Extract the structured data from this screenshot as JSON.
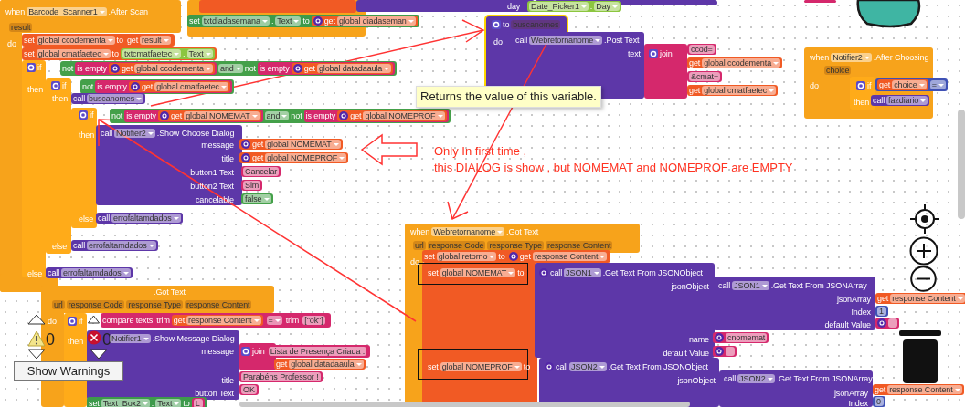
{
  "scripts": [
    {
      "blocks": [
        {
          "kind": "label",
          "parts": [
            {
              "kind": "word",
              "text": "when"
            },
            {
              "kind": "field",
              "text": "Barcode_Scanner1"
            },
            {
              "kind": "word",
              "text": ".After Scan"
            }
          ]
        },
        {
          "kind": "label",
          "parts": [
            {
              "kind": "chip",
              "text": "result"
            }
          ]
        },
        {
          "kind": "label",
          "parts": [
            {
              "kind": "word",
              "text": "do"
            }
          ]
        },
        {
          "kind": "variable",
          "parts": [
            {
              "kind": "word",
              "text": "set"
            },
            {
              "kind": "field",
              "text": "global ccodementa"
            },
            {
              "kind": "word",
              "text": "to"
            },
            {
              "kind": "variable",
              "parts": [
                {
                  "kind": "word",
                  "text": "get"
                },
                {
                  "kind": "field",
                  "text": "result"
                }
              ]
            }
          ]
        },
        {
          "kind": "variable",
          "parts": [
            {
              "kind": "word",
              "text": "set"
            },
            {
              "kind": "field",
              "text": "global cmatfaetec"
            },
            {
              "kind": "word",
              "text": "to"
            },
            {
              "kind": "component",
              "parts": [
                {
                  "kind": "field",
                  "text": "txtcmatfaetec"
                },
                {
                  "kind": "word",
                  "text": "."
                },
                {
                  "kind": "field",
                  "text": "Text"
                }
              ]
            }
          ]
        },
        {
          "kind": "label",
          "parts": [
            {
              "kind": "gear"
            },
            {
              "kind": "word",
              "text": "if"
            }
          ]
        },
        {
          "kind": "logic",
          "parts": [
            {
              "kind": "word",
              "text": "not"
            },
            {
              "kind": "text",
              "parts": [
                {
                  "kind": "word",
                  "text": "is empty"
                },
                {
                  "kind": "variable",
                  "parts": [
                    {
                      "kind": "help"
                    },
                    {
                      "kind": "word",
                      "text": "get"
                    },
                    {
                      "kind": "field",
                      "text": "global ccodementa"
                    }
                  ]
                }
              ]
            },
            {
              "kind": "field",
              "text": "and"
            },
            {
              "kind": "word",
              "text": "not"
            },
            {
              "kind": "text",
              "parts": [
                {
                  "kind": "word",
                  "text": "is empty"
                },
                {
                  "kind": "variable",
                  "parts": [
                    {
                      "kind": "help"
                    },
                    {
                      "kind": "word",
                      "text": "get"
                    },
                    {
                      "kind": "field",
                      "text": "global datadaaula"
                    }
                  ]
                }
              ]
            }
          ]
        },
        {
          "kind": "label",
          "parts": [
            {
              "kind": "word",
              "text": "then"
            }
          ]
        },
        {
          "kind": "label",
          "parts": [
            {
              "kind": "gear"
            },
            {
              "kind": "word",
              "text": "if"
            }
          ]
        },
        {
          "kind": "logic",
          "parts": [
            {
              "kind": "word",
              "text": "not"
            },
            {
              "kind": "text",
              "parts": [
                {
                  "kind": "word",
                  "text": "is empty"
                },
                {
                  "kind": "variable",
                  "parts": [
                    {
                      "kind": "help"
                    },
                    {
                      "kind": "word",
                      "text": "get"
                    },
                    {
                      "kind": "field",
                      "text": "global cmatfaetec"
                    }
                  ]
                }
              ]
            }
          ]
        },
        {
          "kind": "label",
          "parts": [
            {
              "kind": "word",
              "text": "then"
            }
          ]
        },
        {
          "kind": "procedure",
          "parts": [
            {
              "kind": "word",
              "text": "call"
            },
            {
              "kind": "field",
              "text": "buscanomes"
            }
          ]
        },
        {
          "kind": "label",
          "parts": [
            {
              "kind": "gear"
            },
            {
              "kind": "word",
              "text": "if"
            }
          ]
        },
        {
          "kind": "logic",
          "parts": [
            {
              "kind": "word",
              "text": "not"
            },
            {
              "kind": "text",
              "parts": [
                {
                  "kind": "word",
                  "text": "is empty"
                },
                {
                  "kind": "variable",
                  "parts": [
                    {
                      "kind": "help"
                    },
                    {
                      "kind": "word",
                      "text": "get"
                    },
                    {
                      "kind": "field",
                      "text": "global NOMEMAT"
                    }
                  ]
                }
              ]
            },
            {
              "kind": "field",
              "text": "and"
            },
            {
              "kind": "word",
              "text": "not"
            },
            {
              "kind": "text",
              "parts": [
                {
                  "kind": "word",
                  "text": "is empty"
                },
                {
                  "kind": "variable",
                  "parts": [
                    {
                      "kind": "help"
                    },
                    {
                      "kind": "word",
                      "text": "get"
                    },
                    {
                      "kind": "field",
                      "text": "global NOMEPROF"
                    }
                  ]
                }
              ]
            }
          ]
        },
        {
          "kind": "label",
          "parts": [
            {
              "kind": "word",
              "text": "then"
            }
          ]
        },
        {
          "kind": "label",
          "parts": [
            {
              "kind": "word",
              "text": "call"
            },
            {
              "kind": "field",
              "text": "Notifier2"
            },
            {
              "kind": "word",
              "text": ".Show Choose Dialog"
            }
          ]
        },
        {
          "kind": "label",
          "parts": [
            {
              "kind": "word",
              "text": "message"
            }
          ]
        },
        {
          "kind": "label",
          "parts": [
            {
              "kind": "word",
              "text": "title"
            }
          ]
        },
        {
          "kind": "label",
          "parts": [
            {
              "kind": "word",
              "text": "button1 Text"
            }
          ]
        },
        {
          "kind": "label",
          "parts": [
            {
              "kind": "word",
              "text": "button2 Text"
            }
          ]
        },
        {
          "kind": "label",
          "parts": [
            {
              "kind": "word",
              "text": "cancelable"
            }
          ]
        },
        {
          "kind": "variable",
          "parts": [
            {
              "kind": "help"
            },
            {
              "kind": "word",
              "text": "get"
            },
            {
              "kind": "field",
              "text": "global NOMEMAT"
            }
          ]
        },
        {
          "kind": "variable",
          "parts": [
            {
              "kind": "help"
            },
            {
              "kind": "word",
              "text": "get"
            },
            {
              "kind": "field",
              "text": "global NOMEPROF"
            }
          ]
        },
        {
          "kind": "text",
          "parts": [
            {
              "kind": "chip",
              "text": "Cancelar"
            }
          ]
        },
        {
          "kind": "text",
          "parts": [
            {
              "kind": "chip",
              "text": "Sim"
            }
          ]
        },
        {
          "kind": "logic",
          "parts": [
            {
              "kind": "field",
              "text": "false"
            }
          ]
        },
        {
          "kind": "label",
          "parts": [
            {
              "kind": "word",
              "text": "else"
            }
          ]
        },
        {
          "kind": "procedure",
          "parts": [
            {
              "kind": "word",
              "text": "call"
            },
            {
              "kind": "field",
              "text": "errofaltamdados"
            }
          ]
        },
        {
          "kind": "label",
          "parts": [
            {
              "kind": "word",
              "text": "else"
            }
          ]
        },
        {
          "kind": "procedure",
          "parts": [
            {
              "kind": "word",
              "text": "call"
            },
            {
              "kind": "field",
              "text": "errofaltamdados"
            }
          ]
        },
        {
          "kind": "label",
          "parts": [
            {
              "kind": "word",
              "text": "else"
            }
          ]
        },
        {
          "kind": "procedure",
          "parts": [
            {
              "kind": "word",
              "text": "call"
            },
            {
              "kind": "field",
              "text": "errofaltamdados"
            }
          ]
        }
      ]
    },
    {
      "blocks": [
        {
          "kind": "setter",
          "parts": [
            {
              "kind": "word",
              "text": "set"
            },
            {
              "kind": "field",
              "text": "txtdiadasemana"
            },
            {
              "kind": "word",
              "text": "."
            },
            {
              "kind": "field",
              "text": "Text"
            },
            {
              "kind": "word",
              "text": "to"
            },
            {
              "kind": "variable",
              "parts": [
                {
                  "kind": "help"
                },
                {
                  "kind": "word",
                  "text": "get"
                },
                {
                  "kind": "field",
                  "text": "global diadaseman"
                }
              ]
            }
          ]
        },
        {
          "kind": "label",
          "parts": [
            {
              "kind": "word",
              "text": "day"
            }
          ]
        },
        {
          "kind": "component",
          "parts": [
            {
              "kind": "field",
              "text": "Date_Picker1"
            },
            {
              "kind": "word",
              "text": "."
            },
            {
              "kind": "field",
              "text": "Day"
            }
          ]
        }
      ]
    },
    {
      "blocks": [
        {
          "kind": "label",
          "parts": [
            {
              "kind": "gear"
            },
            {
              "kind": "word",
              "text": "to"
            },
            {
              "kind": "chip",
              "text": "buscanomes"
            }
          ]
        },
        {
          "kind": "label",
          "parts": [
            {
              "kind": "word",
              "text": "do"
            }
          ]
        },
        {
          "kind": "label",
          "parts": [
            {
              "kind": "word",
              "text": "call"
            },
            {
              "kind": "field",
              "text": "Webretornanome"
            },
            {
              "kind": "word",
              "text": ".Post Text"
            }
          ]
        },
        {
          "kind": "label",
          "parts": [
            {
              "kind": "word",
              "text": "text"
            }
          ]
        },
        {
          "kind": "label",
          "parts": [
            {
              "kind": "gear"
            },
            {
              "kind": "word",
              "text": "join"
            }
          ]
        },
        {
          "kind": "text",
          "parts": [
            {
              "kind": "chip",
              "text": "ccod="
            }
          ]
        },
        {
          "kind": "variable",
          "parts": [
            {
              "kind": "word",
              "text": "get"
            },
            {
              "kind": "field",
              "text": "global ccodementa"
            }
          ]
        },
        {
          "kind": "text",
          "parts": [
            {
              "kind": "chip",
              "text": "&cmat="
            }
          ]
        },
        {
          "kind": "variable",
          "parts": [
            {
              "kind": "word",
              "text": "get"
            },
            {
              "kind": "field",
              "text": "global cmatfaetec"
            }
          ]
        }
      ]
    },
    {
      "blocks": [
        {
          "kind": "label",
          "parts": [
            {
              "kind": "word",
              "text": "when"
            },
            {
              "kind": "field",
              "text": "Notifier2"
            },
            {
              "kind": "word",
              "text": ".After Choosing"
            }
          ]
        },
        {
          "kind": "label",
          "parts": [
            {
              "kind": "chip",
              "text": "choice"
            }
          ]
        },
        {
          "kind": "label",
          "parts": [
            {
              "kind": "word",
              "text": "do"
            }
          ]
        },
        {
          "kind": "label",
          "parts": [
            {
              "kind": "gear"
            },
            {
              "kind": "word",
              "text": "if"
            }
          ]
        },
        {
          "kind": "math",
          "parts": [
            {
              "kind": "variable",
              "parts": [
                {
                  "kind": "word",
                  "text": "get"
                },
                {
                  "kind": "field",
                  "text": "choice"
                }
              ]
            },
            {
              "kind": "field",
              "text": "="
            }
          ]
        },
        {
          "kind": "label",
          "parts": [
            {
              "kind": "word",
              "text": "then"
            }
          ]
        },
        {
          "kind": "procedure",
          "parts": [
            {
              "kind": "word",
              "text": "call"
            },
            {
              "kind": "field",
              "text": "fazdiario"
            }
          ]
        }
      ]
    },
    {
      "blocks": [
        {
          "kind": "label",
          "parts": [
            {
              "kind": "word",
              "text": ".Got Text"
            }
          ]
        },
        {
          "kind": "label",
          "parts": [
            {
              "kind": "chip",
              "text": "url"
            },
            {
              "kind": "chip",
              "text": "response Code"
            },
            {
              "kind": "chip",
              "text": "response Type"
            },
            {
              "kind": "chip",
              "text": "response Content"
            }
          ]
        },
        {
          "kind": "label",
          "parts": [
            {
              "kind": "word",
              "text": "do"
            }
          ]
        },
        {
          "kind": "label",
          "parts": [
            {
              "kind": "gear"
            },
            {
              "kind": "word",
              "text": "if"
            }
          ]
        },
        {
          "kind": "text",
          "parts": [
            {
              "kind": "word",
              "text": "compare texts"
            },
            {
              "kind": "text",
              "parts": [
                {
                  "kind": "word",
                  "text": "trim"
                },
                {
                  "kind": "variable",
                  "parts": [
                    {
                      "kind": "word",
                      "text": "get"
                    },
                    {
                      "kind": "field",
                      "text": "response Content"
                    }
                  ]
                }
              ]
            },
            {
              "kind": "field",
              "text": "="
            },
            {
              "kind": "text",
              "parts": [
                {
                  "kind": "word",
                  "text": "trim"
                },
                {
                  "kind": "text",
                  "parts": [
                    {
                      "kind": "chip",
                      "text": "[\"ok\"]"
                    }
                  ]
                }
              ]
            }
          ]
        },
        {
          "kind": "label",
          "parts": [
            {
              "kind": "word",
              "text": "then"
            }
          ]
        },
        {
          "kind": "label",
          "parts": [
            {
              "kind": "field",
              "text": "Notifier1"
            },
            {
              "kind": "word",
              "text": ".Show Message Dialog"
            }
          ]
        },
        {
          "kind": "label",
          "parts": [
            {
              "kind": "word",
              "text": "message"
            }
          ]
        },
        {
          "kind": "label",
          "parts": [
            {
              "kind": "word",
              "text": "title"
            }
          ]
        },
        {
          "kind": "label",
          "parts": [
            {
              "kind": "word",
              "text": "button Text"
            }
          ]
        },
        {
          "kind": "text",
          "parts": [
            {
              "kind": "gear"
            },
            {
              "kind": "word",
              "text": "join"
            },
            {
              "kind": "text",
              "parts": [
                {
                  "kind": "chip",
                  "text": "Lista de Presença Criada :"
                }
              ]
            }
          ]
        },
        {
          "kind": "variable",
          "parts": [
            {
              "kind": "word",
              "text": "get"
            },
            {
              "kind": "field",
              "text": "global datadaaula"
            }
          ]
        },
        {
          "kind": "text",
          "parts": [
            {
              "kind": "chip",
              "text": "Parabéns Professor !"
            }
          ]
        },
        {
          "kind": "text",
          "parts": [
            {
              "kind": "chip",
              "text": "OK"
            }
          ]
        },
        {
          "kind": "setter",
          "parts": [
            {
              "kind": "word",
              "text": "set"
            },
            {
              "kind": "field",
              "text": "Text_Box2"
            },
            {
              "kind": "word",
              "text": "."
            },
            {
              "kind": "field",
              "text": "Text"
            },
            {
              "kind": "word",
              "text": "to"
            },
            {
              "kind": "text",
              "parts": [
                {
                  "kind": "chip",
                  "text": "L"
                }
              ]
            }
          ]
        }
      ]
    },
    {
      "blocks": [
        {
          "kind": "label",
          "parts": [
            {
              "kind": "word",
              "text": "when"
            },
            {
              "kind": "field",
              "text": "Webretornanome"
            },
            {
              "kind": "word",
              "text": ".Got Text"
            }
          ]
        },
        {
          "kind": "label",
          "parts": [
            {
              "kind": "chip",
              "text": "url"
            },
            {
              "kind": "chip",
              "text": "response Code"
            },
            {
              "kind": "chip",
              "text": "response Type"
            },
            {
              "kind": "chip",
              "text": "response Content"
            }
          ]
        },
        {
          "kind": "label",
          "parts": [
            {
              "kind": "word",
              "text": "do"
            }
          ]
        },
        {
          "kind": "variable",
          "parts": [
            {
              "kind": "word",
              "text": "set"
            },
            {
              "kind": "field",
              "text": "global retorno"
            },
            {
              "kind": "word",
              "text": "to"
            },
            {
              "kind": "variable",
              "parts": [
                {
                  "kind": "help"
                },
                {
                  "kind": "word",
                  "text": "get"
                },
                {
                  "kind": "field",
                  "text": "response Content"
                }
              ]
            }
          ]
        },
        {
          "kind": "label",
          "parts": [
            {
              "kind": "word",
              "text": "set"
            },
            {
              "kind": "field",
              "text": "global NOMEMAT"
            },
            {
              "kind": "word",
              "text": "to"
            }
          ]
        },
        {
          "kind": "label",
          "parts": [
            {
              "kind": "help"
            },
            {
              "kind": "word",
              "text": "call"
            },
            {
              "kind": "field",
              "text": "JSON1"
            },
            {
              "kind": "word",
              "text": ".Get Text From JSONObject"
            }
          ]
        },
        {
          "kind": "label",
          "parts": [
            {
              "kind": "word",
              "text": "jsonObject"
            }
          ]
        },
        {
          "kind": "label",
          "parts": [
            {
              "kind": "word",
              "text": "call"
            },
            {
              "kind": "field",
              "text": "JSON1"
            },
            {
              "kind": "word",
              "text": ".Get Text From JSONArray"
            }
          ]
        },
        {
          "kind": "label",
          "parts": [
            {
              "kind": "word",
              "text": "jsonArray"
            }
          ]
        },
        {
          "kind": "label",
          "parts": [
            {
              "kind": "word",
              "text": "Index"
            }
          ]
        },
        {
          "kind": "label",
          "parts": [
            {
              "kind": "word",
              "text": "default Value"
            }
          ]
        },
        {
          "kind": "variable",
          "parts": [
            {
              "kind": "word",
              "text": "get"
            },
            {
              "kind": "field",
              "text": "response Content"
            }
          ]
        },
        {
          "kind": "math",
          "parts": [
            {
              "kind": "chip",
              "text": "1"
            }
          ]
        },
        {
          "kind": "text",
          "parts": [
            {
              "kind": "help"
            },
            {
              "kind": "chip"
            }
          ]
        },
        {
          "kind": "label",
          "parts": [
            {
              "kind": "word",
              "text": "name"
            }
          ]
        },
        {
          "kind": "label",
          "parts": [
            {
              "kind": "word",
              "text": "default Value"
            }
          ]
        },
        {
          "kind": "text",
          "parts": [
            {
              "kind": "help"
            },
            {
              "kind": "chip",
              "text": "cnomemat"
            }
          ]
        },
        {
          "kind": "text",
          "parts": [
            {
              "kind": "help"
            },
            {
              "kind": "chip"
            }
          ]
        },
        {
          "kind": "label",
          "parts": [
            {
              "kind": "word",
              "text": "set"
            },
            {
              "kind": "field",
              "text": "global NOMEPROF"
            },
            {
              "kind": "word",
              "text": "to"
            }
          ]
        },
        {
          "kind": "label",
          "parts": [
            {
              "kind": "help"
            },
            {
              "kind": "word",
              "text": "call"
            },
            {
              "kind": "field",
              "text": "JSON2"
            },
            {
              "kind": "word",
              "text": ".Get Text From JSONObject"
            }
          ]
        },
        {
          "kind": "label",
          "parts": [
            {
              "kind": "word",
              "text": "jsonObject"
            }
          ]
        },
        {
          "kind": "label",
          "parts": [
            {
              "kind": "word",
              "text": "call"
            },
            {
              "kind": "field",
              "text": "JSON2"
            },
            {
              "kind": "word",
              "text": ".Get Text From JSONArray"
            }
          ]
        },
        {
          "kind": "label",
          "parts": [
            {
              "kind": "word",
              "text": "jsonArray"
            }
          ]
        },
        {
          "kind": "label",
          "parts": [
            {
              "kind": "word",
              "text": "Index"
            }
          ]
        },
        {
          "kind": "variable",
          "parts": [
            {
              "kind": "word",
              "text": "get"
            },
            {
              "kind": "field",
              "text": "response Content"
            }
          ]
        },
        {
          "kind": "math",
          "parts": [
            {
              "kind": "chip",
              "text": "0"
            }
          ]
        }
      ]
    }
  ],
  "tooltip": "Returns the value of this variable.",
  "annotation": [
    "Only In first time ,",
    "this DIALOG is show , but NOMEMAT and NOMEPROF are EMPTY"
  ],
  "warnings": {
    "count": "0"
  },
  "errors": {
    "count": "0"
  },
  "show_warnings_button": "Show Warnings"
}
